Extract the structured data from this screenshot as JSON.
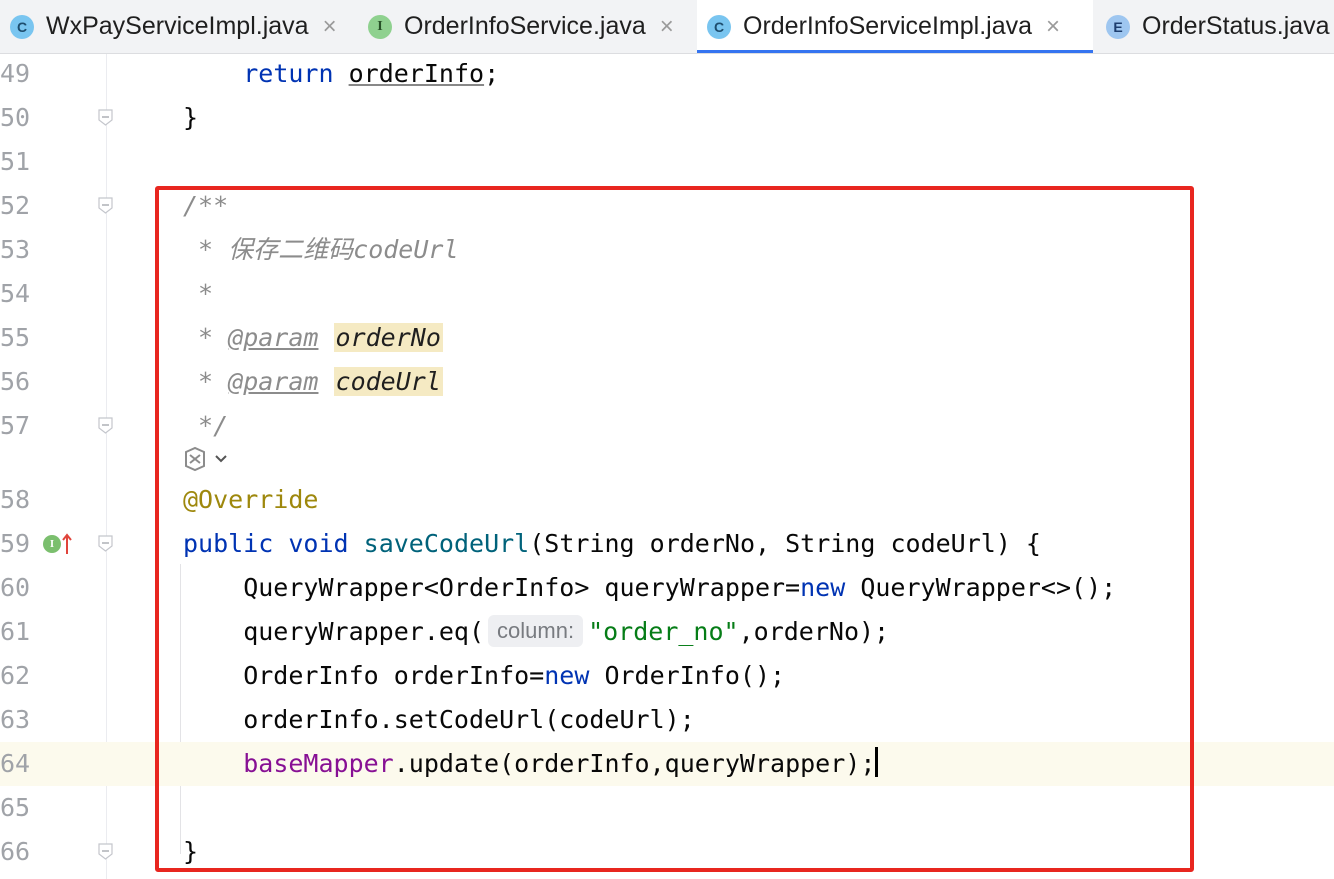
{
  "tabs": [
    {
      "icon": "C",
      "label": "WxPayServiceImpl.java",
      "close": "×",
      "active": false
    },
    {
      "icon": "I",
      "label": "OrderInfoService.java",
      "close": "×",
      "active": false
    },
    {
      "icon": "C",
      "label": "OrderInfoServiceImpl.java",
      "close": "×",
      "active": true
    },
    {
      "icon": "E",
      "label": "OrderStatus.java",
      "close": "",
      "active": false
    }
  ],
  "lines": [
    {
      "num": "49",
      "tokens": [
        [
          "",
          "    "
        ],
        [
          "kw",
          "return"
        ],
        [
          "",
          " "
        ],
        [
          "under",
          "orderInfo"
        ],
        [
          "",
          ";"
        ]
      ]
    },
    {
      "num": "50",
      "tokens": [
        [
          "",
          "}"
        ]
      ]
    },
    {
      "num": "51",
      "tokens": []
    },
    {
      "num": "52",
      "tokens": [
        [
          "cm",
          "/**"
        ]
      ]
    },
    {
      "num": "53",
      "tokens": [
        [
          "cm",
          " * 保存二维码codeUrl"
        ]
      ]
    },
    {
      "num": "54",
      "tokens": [
        [
          "cm",
          " *"
        ]
      ]
    },
    {
      "num": "55",
      "tokens": [
        [
          "cm",
          " * "
        ],
        [
          "cm-tag",
          "@param"
        ],
        [
          "cm",
          " "
        ],
        [
          "param",
          "orderNo"
        ]
      ]
    },
    {
      "num": "56",
      "tokens": [
        [
          "cm",
          " * "
        ],
        [
          "cm-tag",
          "@param"
        ],
        [
          "cm",
          " "
        ],
        [
          "param",
          "codeUrl"
        ]
      ]
    },
    {
      "num": "57",
      "tokens": [
        [
          "cm",
          " */"
        ]
      ]
    },
    {
      "num": "58",
      "tokens": [
        [
          "ann",
          "@Override"
        ]
      ]
    },
    {
      "num": "59",
      "tokens": [
        [
          "kw",
          "public"
        ],
        [
          "",
          " "
        ],
        [
          "kw",
          "void"
        ],
        [
          "",
          " "
        ],
        [
          "fn",
          "saveCodeUrl"
        ],
        [
          "",
          "(String orderNo, String codeUrl) {"
        ]
      ]
    },
    {
      "num": "60",
      "tokens": [
        [
          "",
          "    QueryWrapper<OrderInfo> queryWrapper="
        ],
        [
          "kw",
          "new"
        ],
        [
          "",
          " QueryWrapper<>();"
        ]
      ]
    },
    {
      "num": "61",
      "tokens": [
        [
          "",
          "    queryWrapper.eq("
        ],
        [
          "hint",
          "column:"
        ],
        [
          "str",
          "\"order_no\""
        ],
        [
          "",
          ",orderNo);"
        ]
      ]
    },
    {
      "num": "62",
      "tokens": [
        [
          "",
          "    OrderInfo orderInfo="
        ],
        [
          "kw",
          "new"
        ],
        [
          "",
          " OrderInfo();"
        ]
      ]
    },
    {
      "num": "63",
      "tokens": [
        [
          "",
          "    orderInfo.setCodeUrl(codeUrl);"
        ]
      ]
    },
    {
      "num": "64",
      "tokens": [
        [
          "",
          "    "
        ],
        [
          "field",
          "baseMapper"
        ],
        [
          "",
          ".update(orderInfo,queryWrapper);"
        ]
      ],
      "current": true
    },
    {
      "num": "65",
      "tokens": []
    },
    {
      "num": "66",
      "tokens": [
        [
          "",
          "}"
        ]
      ]
    }
  ],
  "icons": {
    "fold": "fold-marker-icon",
    "ai_assist": "ai-assistant-icon",
    "chevron": "chevron-down-icon",
    "implements": "implements-method-icon",
    "arrow": "override-arrow-icon"
  },
  "implements_badge": "I",
  "colors": {
    "highlight": "#e8261f",
    "active_tab": "#3574f0"
  }
}
